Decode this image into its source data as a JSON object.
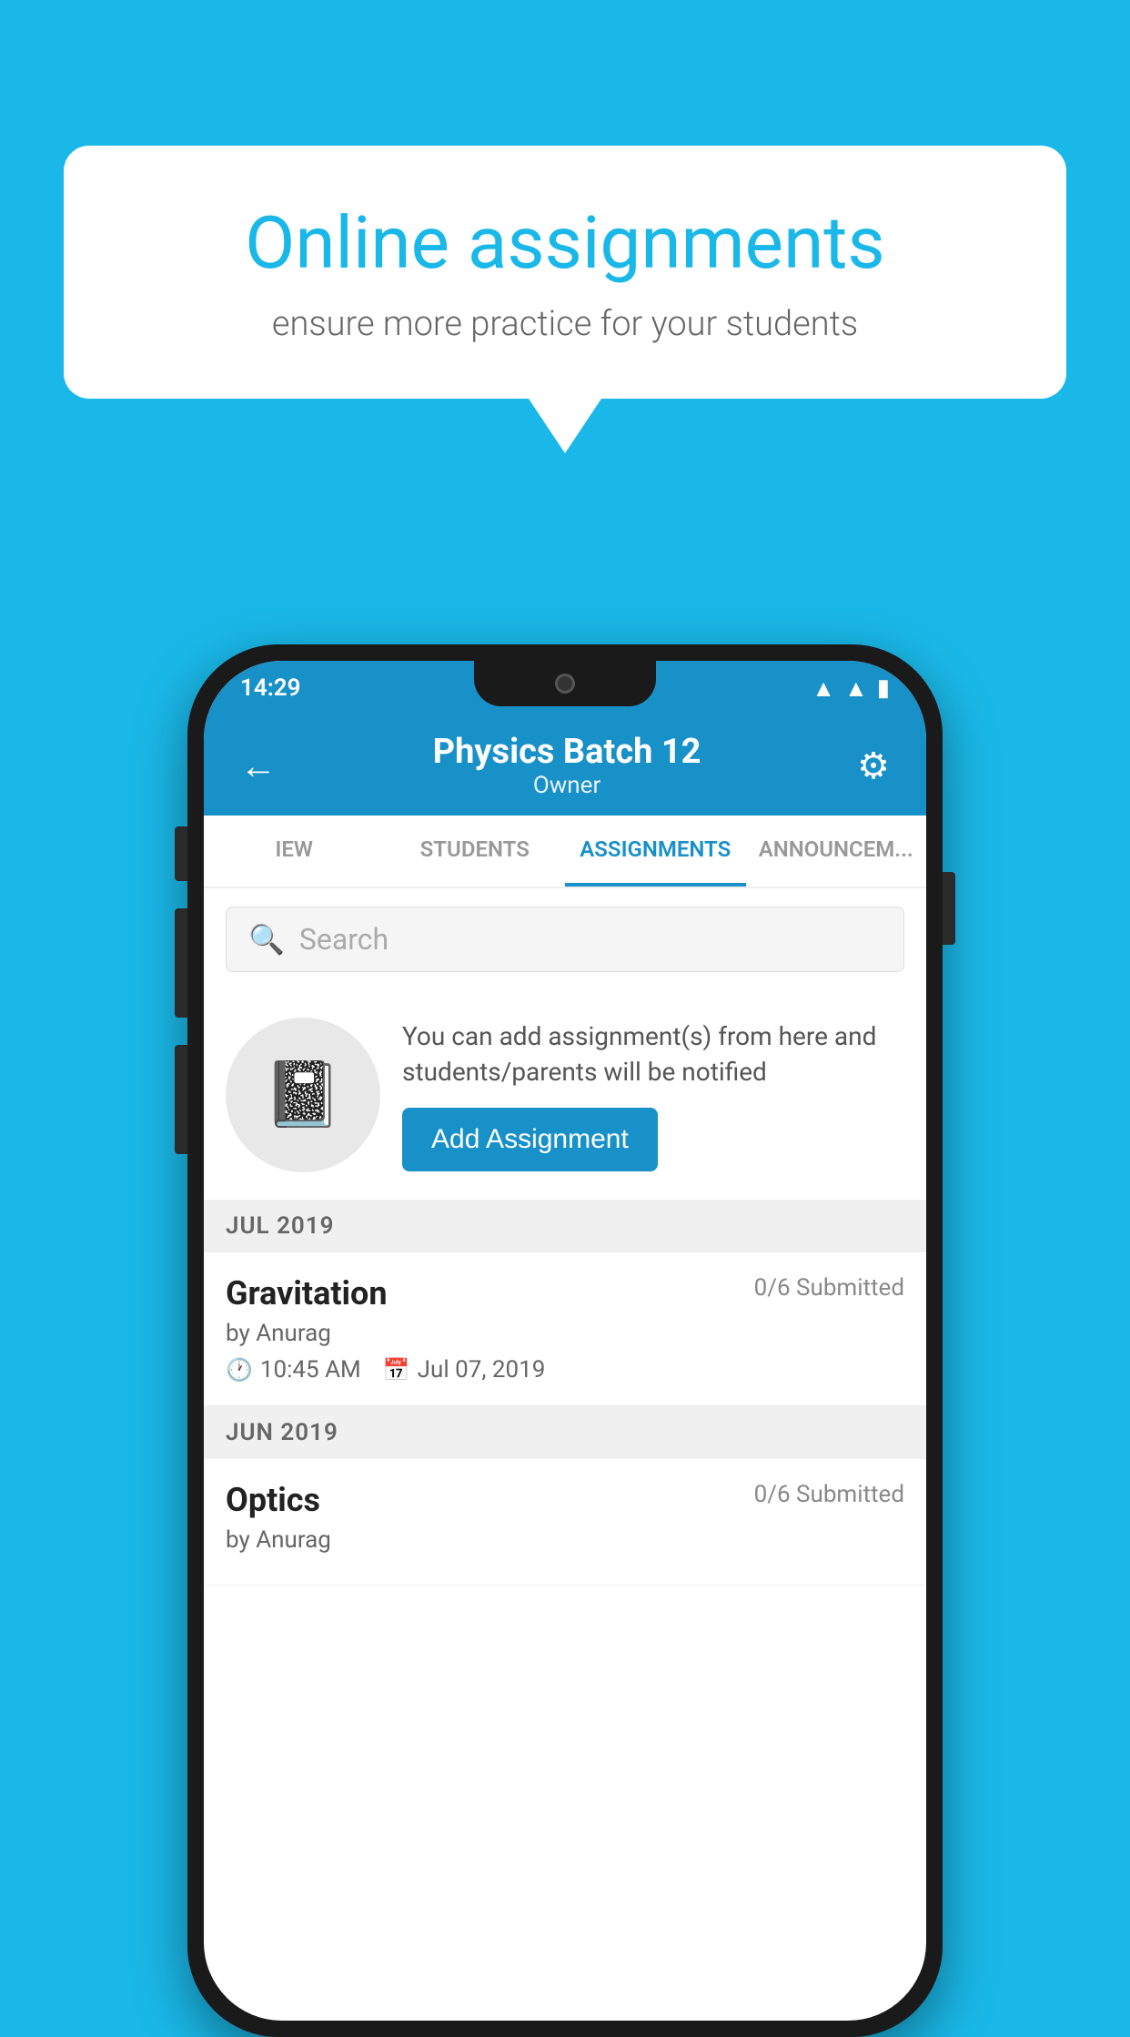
{
  "background_color": "#1ab8e8",
  "speech_bubble": {
    "title": "Online assignments",
    "subtitle": "ensure more practice for your students"
  },
  "status_bar": {
    "time": "14:29",
    "icons": [
      "wifi",
      "signal",
      "battery"
    ]
  },
  "app_bar": {
    "title": "Physics Batch 12",
    "subtitle": "Owner",
    "back_label": "←",
    "settings_label": "⚙"
  },
  "tabs": [
    {
      "label": "IEW",
      "active": false
    },
    {
      "label": "STUDENTS",
      "active": false
    },
    {
      "label": "ASSIGNMENTS",
      "active": true
    },
    {
      "label": "ANNOUNCEM...",
      "active": false
    }
  ],
  "search": {
    "placeholder": "Search"
  },
  "promo_card": {
    "description": "You can add assignment(s) from here and students/parents will be notified",
    "button_label": "Add Assignment"
  },
  "sections": [
    {
      "label": "JUL 2019",
      "assignments": [
        {
          "title": "Gravitation",
          "submitted": "0/6 Submitted",
          "by": "by Anurag",
          "time": "10:45 AM",
          "date": "Jul 07, 2019"
        }
      ]
    },
    {
      "label": "JUN 2019",
      "assignments": [
        {
          "title": "Optics",
          "submitted": "0/6 Submitted",
          "by": "by Anurag",
          "time": "",
          "date": ""
        }
      ]
    }
  ]
}
